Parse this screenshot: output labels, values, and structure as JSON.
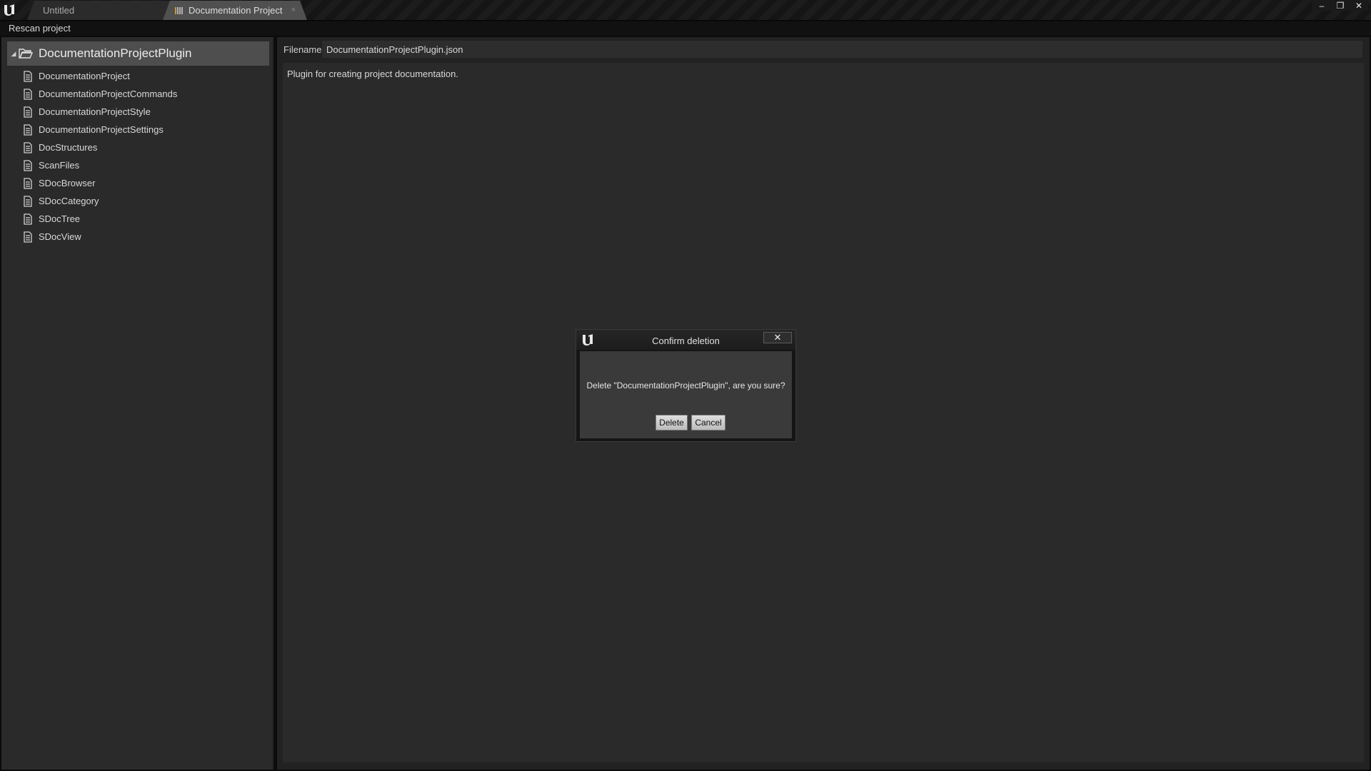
{
  "window": {
    "tabs": [
      {
        "label": "Untitled"
      },
      {
        "label": "Documentation Project",
        "close": "×"
      }
    ],
    "controls": {
      "minimize": "‒",
      "restore": "❐",
      "close": "✕"
    }
  },
  "toolbar": {
    "rescan_label": "Rescan project"
  },
  "tree": {
    "root": {
      "caret": "◢",
      "label": "DocumentationProjectPlugin"
    },
    "items": [
      {
        "label": "DocumentationProject"
      },
      {
        "label": "DocumentationProjectCommands"
      },
      {
        "label": "DocumentationProjectStyle"
      },
      {
        "label": "DocumentationProjectSettings"
      },
      {
        "label": "DocStructures"
      },
      {
        "label": "ScanFiles"
      },
      {
        "label": "SDocBrowser"
      },
      {
        "label": "SDocCategory"
      },
      {
        "label": "SDocTree"
      },
      {
        "label": "SDocView"
      }
    ]
  },
  "details": {
    "filename_label": "Filename",
    "filename_value": "DocumentationProjectPlugin.json",
    "description": "Plugin for creating project documentation."
  },
  "dialog": {
    "title": "Confirm deletion",
    "close": "✕",
    "message": "Delete \"DocumentationProjectPlugin\", are you sure?",
    "delete_label": "Delete",
    "cancel_label": "Cancel"
  }
}
